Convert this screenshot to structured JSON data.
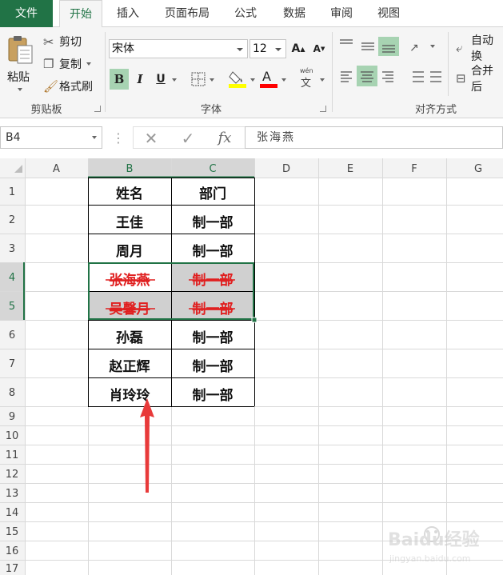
{
  "tabs": [
    "文件",
    "开始",
    "插入",
    "页面布局",
    "公式",
    "数据",
    "审阅",
    "视图"
  ],
  "ribbon": {
    "clipboard": {
      "paste": "粘贴",
      "cut": "剪切",
      "copy": "复制",
      "format_painter": "格式刷",
      "label": "剪贴板"
    },
    "font": {
      "name": "宋体",
      "size": "12",
      "bold": "B",
      "italic": "I",
      "underline": "U",
      "phonetic": "wén",
      "phonetic_char": "文",
      "label": "字体",
      "fill_color": "#ffff00",
      "font_color": "#ff0000"
    },
    "alignment": {
      "wrap": "自动换",
      "merge": "合并后",
      "label": "对齐方式"
    }
  },
  "formula_bar": {
    "name_box": "B4",
    "fx": "fx",
    "value": "张海燕"
  },
  "grid": {
    "columns": [
      "A",
      "B",
      "C",
      "D",
      "E",
      "F",
      "G"
    ],
    "rows": [
      "1",
      "2",
      "3",
      "4",
      "5",
      "6",
      "7",
      "8",
      "9",
      "10",
      "11",
      "12",
      "13",
      "14",
      "15",
      "16",
      "17"
    ],
    "table": [
      {
        "b": "姓名",
        "c": "部门",
        "strike": false
      },
      {
        "b": "王佳",
        "c": "制一部",
        "strike": false
      },
      {
        "b": "周月",
        "c": "制一部",
        "strike": false
      },
      {
        "b": "张海燕",
        "c": "制一部",
        "strike": true
      },
      {
        "b": "吴馨月",
        "c": "制一部",
        "strike": true
      },
      {
        "b": "孙磊",
        "c": "制一部",
        "strike": false
      },
      {
        "b": "赵正辉",
        "c": "制一部",
        "strike": false
      },
      {
        "b": "肖玲玲",
        "c": "制一部",
        "strike": false
      }
    ],
    "strike_color": "#e02020",
    "selection_color": "#217346",
    "arrow_color": "#e83a3a"
  },
  "watermark": {
    "brand": "Baidu经验",
    "url": "jingyan.baidu.com"
  }
}
